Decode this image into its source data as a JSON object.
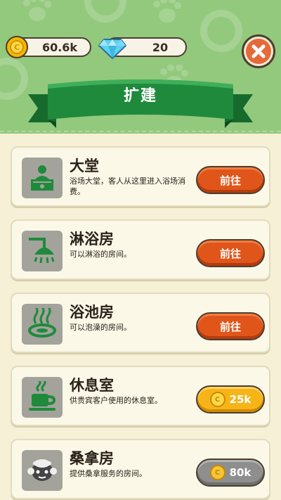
{
  "header": {
    "coins": "60.6k",
    "gems": "20",
    "title": "扩建"
  },
  "colors": {
    "top_background": "#93c97d",
    "ribbon_green": "#1f8a3c",
    "go_button": "#e0561a",
    "price_button": "#f6b419",
    "locked_price_button": "#8e8e8e",
    "close_button": "#e56a3a"
  },
  "rooms": [
    {
      "title": "大堂",
      "desc": "浴场大堂，客人从这里进入浴场消费。",
      "button": "前往",
      "icon": "reception-desk-icon"
    },
    {
      "title": "淋浴房",
      "desc": "可以淋浴的房间。",
      "button": "前往",
      "icon": "shower-icon"
    },
    {
      "title": "浴池房",
      "desc": "可以泡澡的房间。",
      "button": "前往",
      "icon": "hot-spring-icon"
    },
    {
      "title": "休息室",
      "desc": "供贵宾客户使用的休息室。",
      "button": "25k",
      "icon": "coffee-cup-icon"
    },
    {
      "title": "桑拿房",
      "desc": "提供桑拿服务的房间。",
      "button": "80k",
      "icon": "sauna-face-icon"
    }
  ]
}
